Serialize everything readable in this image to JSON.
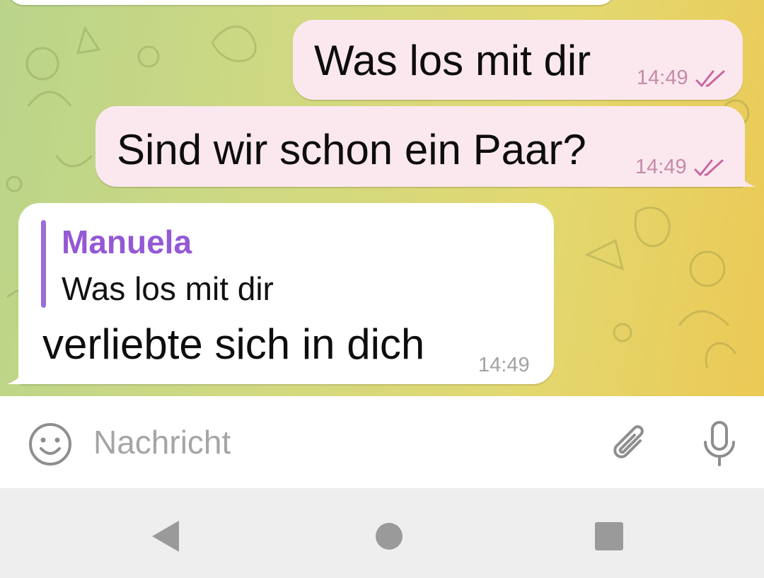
{
  "messages": [
    {
      "direction": "outgoing",
      "text": "Was los mit dir",
      "time": "14:49",
      "status": "read-double-check-icon"
    },
    {
      "direction": "outgoing",
      "text": "Sind wir schon ein Paar?",
      "time": "14:49",
      "status": "read-double-check-icon"
    },
    {
      "direction": "incoming",
      "reply": {
        "name": "Manuela",
        "text": "Was los mit dir"
      },
      "text": "verliebte sich in dich",
      "time": "14:49"
    }
  ],
  "input": {
    "placeholder": "Nachricht",
    "value": ""
  },
  "icons": {
    "emoji": "smiley-icon",
    "attach": "paperclip-icon",
    "voice": "microphone-icon",
    "nav_back": "back-triangle-icon",
    "nav_home": "home-circle-icon",
    "nav_recents": "recents-square-icon"
  },
  "colors": {
    "outgoing_bubble": "#fbe8ef",
    "incoming_bubble": "#ffffff",
    "reply_accent": "#9459d4",
    "read_check": "#c767a0",
    "wallpaper_start": "#b9d48a",
    "wallpaper_end": "#ecc955"
  }
}
